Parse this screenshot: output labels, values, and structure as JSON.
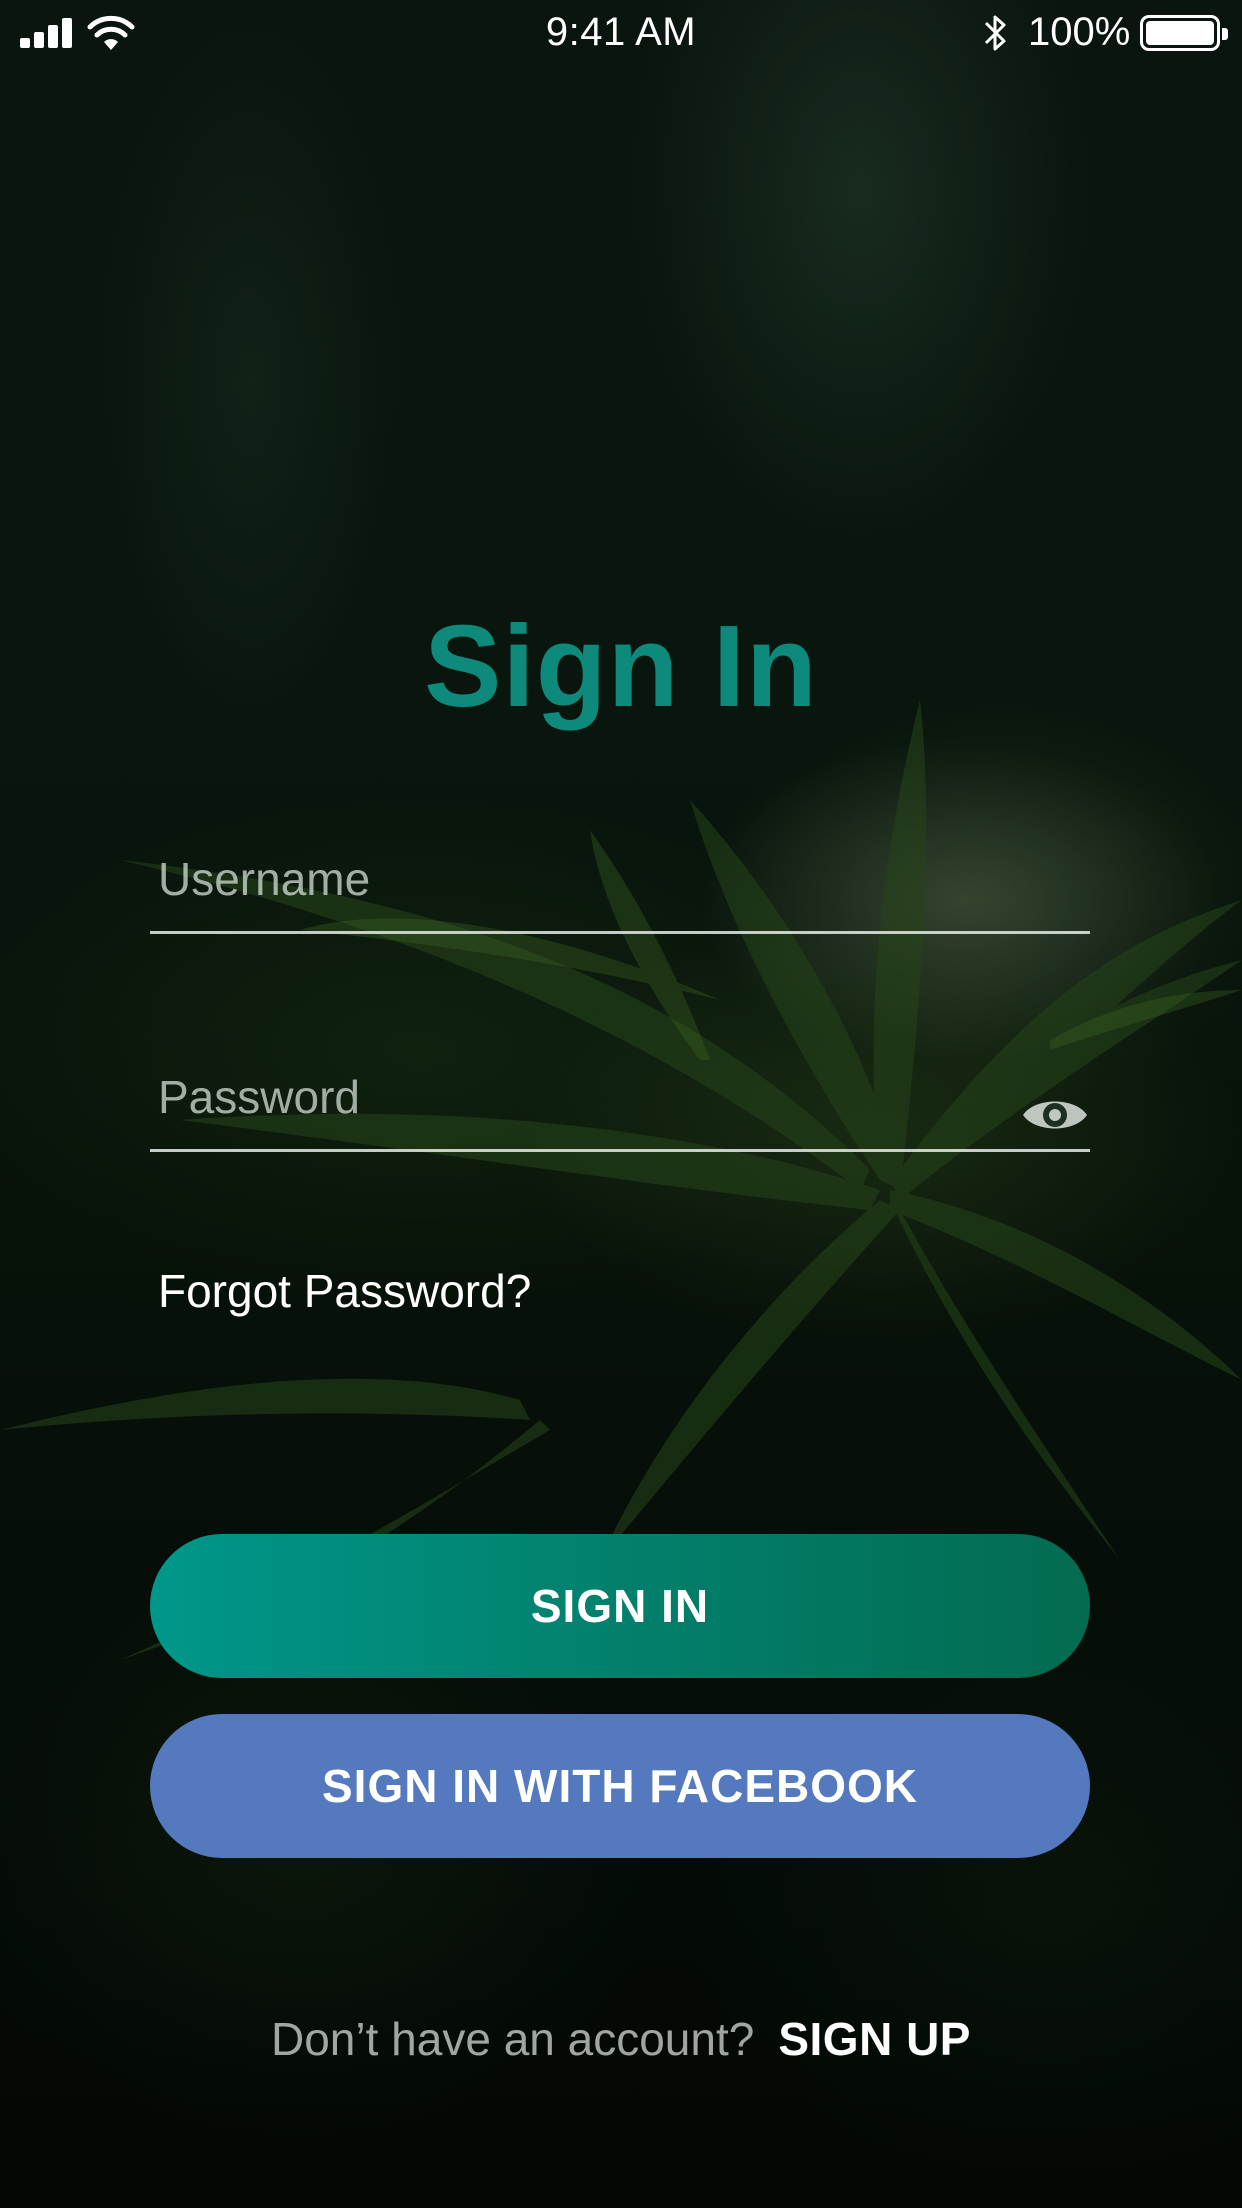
{
  "status_bar": {
    "time": "9:41 AM",
    "battery_percent": "100%",
    "battery_level": 1.0,
    "icons": [
      "signal-icon",
      "wifi-icon",
      "bluetooth-icon",
      "battery-icon"
    ]
  },
  "title": "Sign In",
  "username": {
    "placeholder": "Username",
    "value": ""
  },
  "password": {
    "placeholder": "Password",
    "value": "",
    "toggle_icon": "eye-icon"
  },
  "forgot_password": "Forgot Password?",
  "sign_in_button": "SIGN IN",
  "facebook_button": "SIGN IN WITH FACEBOOK",
  "signup": {
    "prompt": "Don’t have an account?",
    "link": "SIGN UP"
  },
  "colors": {
    "title": "#0d8a7b",
    "sign_in_gradient_start": "#00978a",
    "sign_in_gradient_end": "#036b50",
    "facebook": "#5479be"
  }
}
